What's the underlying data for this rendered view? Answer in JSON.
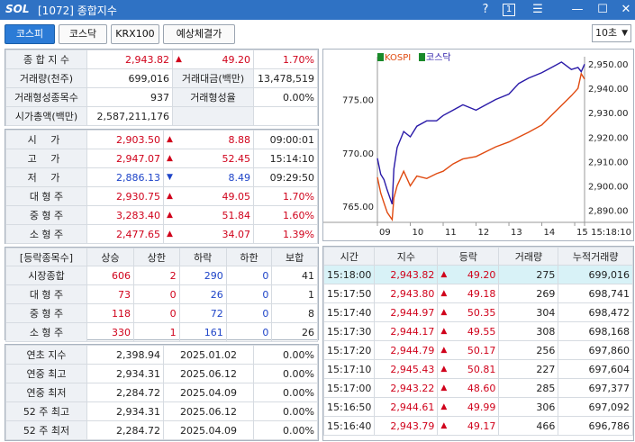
{
  "window": {
    "logo": "SOL",
    "title": "[1072] 종합지수",
    "help": "?",
    "one": "1",
    "menu": "☰",
    "min": "—",
    "max": "☐",
    "close": "✕"
  },
  "tabs": [
    {
      "label": "코스피",
      "active": true
    },
    {
      "label": "코스닥"
    },
    {
      "label": "KRX100"
    },
    {
      "label": "예상체결가"
    }
  ],
  "interval": {
    "selected": "10초"
  },
  "summary": {
    "index_label": "종 합 지 수",
    "index_value": "2,943.82",
    "index_change": "49.20",
    "index_rate": "1.70%",
    "vol_label": "거래량(천주)",
    "vol_value": "699,016",
    "amt_label": "거래대금(백만)",
    "amt_value": "13,478,519",
    "form_cnt_label": "거래형성종목수",
    "form_cnt_value": "937",
    "form_rate_label": "거래형성율",
    "form_rate_value": "0.00%",
    "mcap_label": "시가총액(백만)",
    "mcap_value": "2,587,211,176"
  },
  "ohlc": [
    {
      "label": "시  가",
      "value": "2,903.50",
      "dir": "up",
      "change": "8.88",
      "extra": "09:00:01",
      "color": "red"
    },
    {
      "label": "고  가",
      "value": "2,947.07",
      "dir": "up",
      "change": "52.45",
      "extra": "15:14:10",
      "color": "red"
    },
    {
      "label": "저  가",
      "value": "2,886.13",
      "dir": "dn",
      "change": "8.49",
      "extra": "09:29:50",
      "color": "blue"
    },
    {
      "label": "대 형 주",
      "value": "2,930.75",
      "dir": "up",
      "change": "49.05",
      "extra": "1.70%",
      "color": "red"
    },
    {
      "label": "중 형 주",
      "value": "3,283.40",
      "dir": "up",
      "change": "51.84",
      "extra": "1.60%",
      "color": "red"
    },
    {
      "label": "소 형 주",
      "value": "2,477.65",
      "dir": "up",
      "change": "34.07",
      "extra": "1.39%",
      "color": "red"
    }
  ],
  "breadth": {
    "headers": [
      "[등락종목수]",
      "상승",
      "상한",
      "하락",
      "하한",
      "보합"
    ],
    "rows": [
      [
        "시장종합",
        "606",
        "2",
        "290",
        "0",
        "41"
      ],
      [
        "대 형 주",
        "73",
        "0",
        "26",
        "0",
        "1"
      ],
      [
        "중 형 주",
        "118",
        "0",
        "72",
        "0",
        "8"
      ],
      [
        "소 형 주",
        "330",
        "1",
        "161",
        "0",
        "26"
      ]
    ]
  },
  "yearly": [
    [
      "연초  지수",
      "2,398.94",
      "2025.01.02",
      "0.00%"
    ],
    [
      "연중  최고",
      "2,934.31",
      "2025.06.12",
      "0.00%"
    ],
    [
      "연중  최저",
      "2,284.72",
      "2025.04.09",
      "0.00%"
    ],
    [
      "52 주 최고",
      "2,934.31",
      "2025.06.12",
      "0.00%"
    ],
    [
      "52 주 최저",
      "2,284.72",
      "2025.04.09",
      "0.00%"
    ]
  ],
  "ticks": {
    "headers": [
      "시간",
      "지수",
      "등락",
      "거래량",
      "누적거래량"
    ],
    "rows": [
      [
        "15:18:00",
        "2,943.82",
        "49.20",
        "275",
        "699,016"
      ],
      [
        "15:17:50",
        "2,943.80",
        "49.18",
        "269",
        "698,741"
      ],
      [
        "15:17:40",
        "2,944.97",
        "50.35",
        "304",
        "698,472"
      ],
      [
        "15:17:30",
        "2,944.17",
        "49.55",
        "308",
        "698,168"
      ],
      [
        "15:17:20",
        "2,944.79",
        "50.17",
        "256",
        "697,860"
      ],
      [
        "15:17:10",
        "2,945.43",
        "50.81",
        "227",
        "697,604"
      ],
      [
        "15:17:00",
        "2,943.22",
        "48.60",
        "285",
        "697,377"
      ],
      [
        "15:16:50",
        "2,944.61",
        "49.99",
        "306",
        "697,092"
      ],
      [
        "15:16:40",
        "2,943.79",
        "49.17",
        "466",
        "696,786"
      ]
    ]
  },
  "chart_data": {
    "type": "line",
    "legend": [
      "KOSPI",
      "코스닥"
    ],
    "colors": {
      "KOSPI": "#e04a10",
      "코스닥": "#2a1aa8"
    },
    "left_axis": {
      "ticks": [
        "775.00",
        "770.00",
        "765.00"
      ],
      "values": [
        775,
        770,
        765
      ],
      "range": [
        763.5,
        779
      ]
    },
    "right_axis": {
      "ticks": [
        "2,950.00",
        "2,940.00",
        "2,930.00",
        "2,920.00",
        "2,910.00",
        "2,900.00",
        "2,890.00"
      ],
      "values": [
        2950,
        2940,
        2930,
        2920,
        2910,
        2900,
        2890
      ],
      "range": [
        2885,
        2953
      ]
    },
    "x_ticks": [
      "09",
      "10",
      "11",
      "12",
      "13",
      "14",
      "15",
      "15:18:10"
    ],
    "x_hours": [
      9,
      10,
      11,
      12,
      13,
      14,
      15,
      15.3
    ],
    "series": [
      {
        "name": "KOSPI",
        "axis": "right",
        "x": [
          9.0,
          9.1,
          9.2,
          9.3,
          9.45,
          9.5,
          9.6,
          9.8,
          10.0,
          10.2,
          10.5,
          10.8,
          11.0,
          11.3,
          11.6,
          12.0,
          12.3,
          12.6,
          13.0,
          13.3,
          13.6,
          14.0,
          14.3,
          14.6,
          14.9,
          15.1,
          15.2,
          15.3
        ],
        "values": [
          2903.5,
          2897,
          2893,
          2889,
          2886.1,
          2895,
          2900,
          2906,
          2900,
          2904,
          2903,
          2905,
          2906,
          2909,
          2911,
          2912,
          2914,
          2916,
          2918,
          2920,
          2922,
          2925,
          2929,
          2933,
          2937,
          2940,
          2946,
          2943.8
        ]
      },
      {
        "name": "코스닥",
        "axis": "left",
        "x": [
          9.0,
          9.1,
          9.2,
          9.3,
          9.45,
          9.5,
          9.6,
          9.8,
          10.0,
          10.2,
          10.5,
          10.8,
          11.0,
          11.3,
          11.6,
          12.0,
          12.3,
          12.6,
          13.0,
          13.3,
          13.6,
          14.0,
          14.3,
          14.6,
          14.9,
          15.1,
          15.2,
          15.3
        ],
        "values": [
          769.5,
          768,
          767.5,
          766.5,
          765.2,
          768.5,
          770.5,
          772,
          771.5,
          772.5,
          773,
          773,
          773.5,
          774,
          774.5,
          774,
          774.5,
          775,
          775.5,
          776.5,
          777,
          777.5,
          778,
          778.5,
          777.8,
          778,
          777.6,
          778.3
        ]
      }
    ]
  }
}
